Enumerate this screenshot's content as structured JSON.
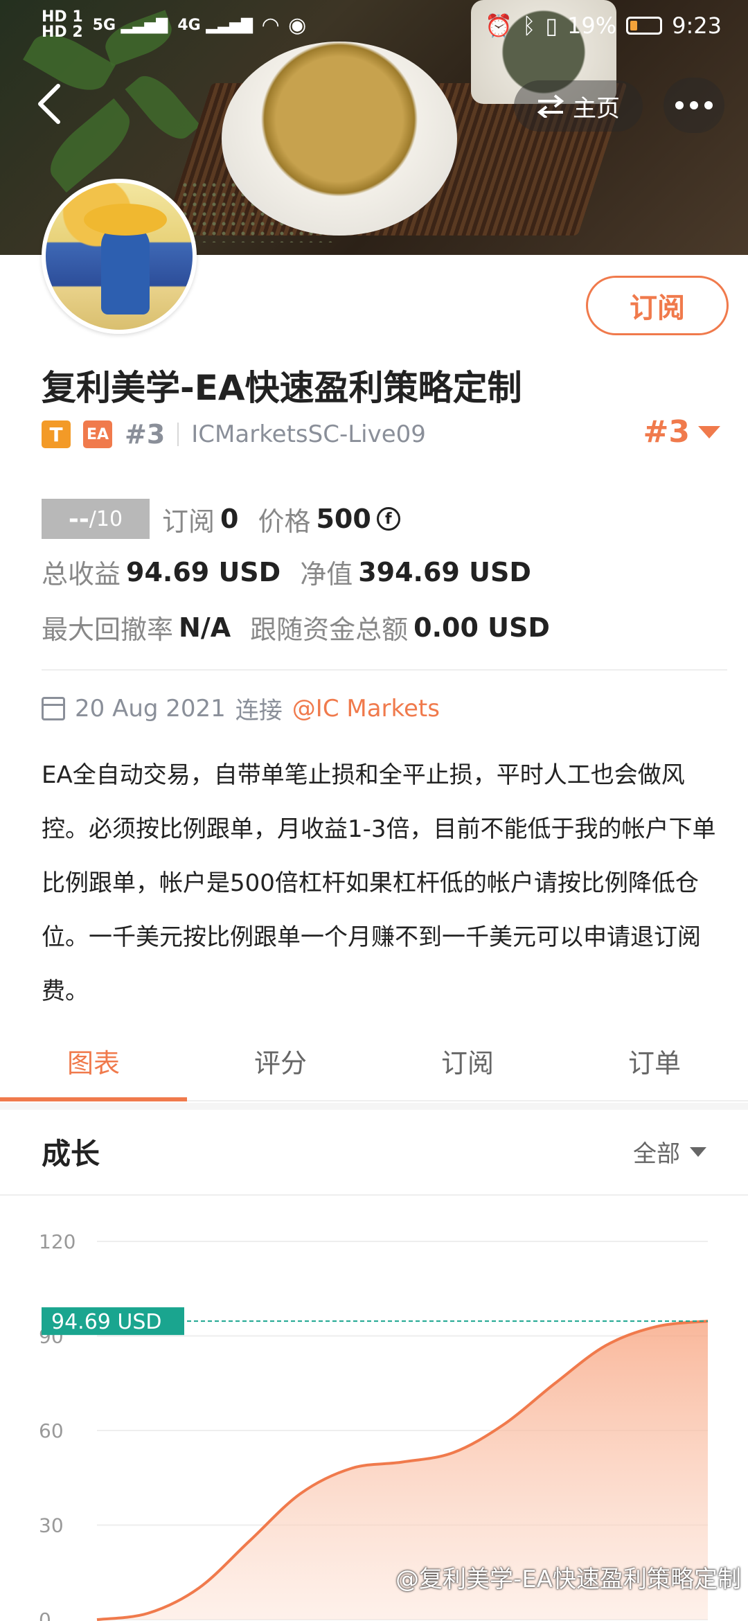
{
  "status_bar": {
    "hd1": "HD 1",
    "hd2": "HD 2",
    "net1": "5G",
    "net2": "4G",
    "battery": "19%",
    "time": "9:23"
  },
  "nav": {
    "back_icon": "chevron-left-icon",
    "home_label": "主页",
    "more_icon": "more-dots-icon"
  },
  "profile": {
    "subscribe_label": "订阅",
    "title": "复利美学-EA快速盈利策略定制",
    "badge_t": "T",
    "badge_ea": "EA",
    "rank_small": "#3",
    "server": "ICMarketsSC-Live09",
    "rank_big": "#3"
  },
  "stats": {
    "score": "--",
    "score_max": "/10",
    "subs_label": "订阅",
    "subs_value": "0",
    "price_label": "价格",
    "price_value": "500",
    "coin_symbol": "f",
    "total_profit_label": "总收益",
    "total_profit_value": "94.69 USD",
    "equity_label": "净值",
    "equity_value": "394.69 USD",
    "drawdown_label": "最大回撤率",
    "drawdown_value": "N/A",
    "follow_label": "跟随资金总额",
    "follow_value": "0.00 USD"
  },
  "connection": {
    "date": "20 Aug 2021",
    "connect_label": "连接",
    "broker": "@IC Markets"
  },
  "description": "EA全自动交易，自带单笔止损和全平止损，平时人工也会做风控。必须按比例跟单，月收益1-3倍，目前不能低于我的帐户下单比例跟单，帐户是500倍杠杆如果杠杆低的帐户请按比例降低仓位。一千美元按比例跟单一个月赚不到一千美元可以申请退订阅费。",
  "tabs": [
    {
      "label": "图表",
      "active": true
    },
    {
      "label": "评分",
      "active": false
    },
    {
      "label": "订阅",
      "active": false
    },
    {
      "label": "订单",
      "active": false
    }
  ],
  "growth": {
    "title": "成长",
    "range": "全部"
  },
  "chart_data": {
    "type": "area",
    "title": "",
    "xlabel": "",
    "ylabel": "",
    "ylim": [
      0,
      120
    ],
    "yticks": [
      "0",
      "30",
      "60",
      "90",
      "120"
    ],
    "current_label": "94.69 USD",
    "current_value": 94.69,
    "x": [
      0,
      1,
      2,
      3,
      4,
      5,
      6,
      7,
      8,
      9,
      10,
      11,
      12
    ],
    "values": [
      0,
      2,
      10,
      25,
      40,
      48,
      50,
      53,
      62,
      75,
      87,
      93,
      94.69
    ],
    "colors": {
      "line": "#f07a4c",
      "fill": "#f9b89b",
      "marker": "#1aa58f"
    }
  },
  "watermark": "@复利美学-EA快速盈利策略定制"
}
